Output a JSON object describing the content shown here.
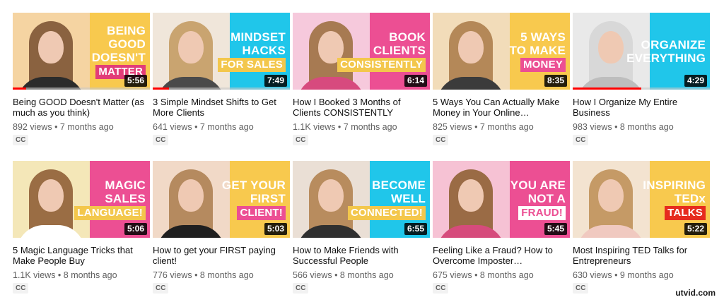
{
  "videos": [
    {
      "title": "Being GOOD Doesn't Matter (as much as you think)",
      "views": "892 views",
      "age": "7 months ago",
      "badge": "CC",
      "duration": "5:56",
      "watched": 0.1,
      "thumbnail": {
        "lines": [
          "BEING",
          "GOOD",
          "DOESN'T",
          "MATTER"
        ],
        "panel_color": "#f8c94e",
        "text_color": "#ffffff",
        "accent_color": "#e23d78",
        "photo_bg": "#f5d4a2",
        "hair_color": "#8a6240",
        "top_color": "#2b2b2b"
      }
    },
    {
      "title": "3 Simple Mindset Shifts to Get More Clients",
      "views": "641 views",
      "age": "7 months ago",
      "badge": "CC",
      "duration": "7:49",
      "watched": 0.12,
      "thumbnail": {
        "lines": [
          "MINDSET",
          "HACKS",
          "FOR SALES"
        ],
        "panel_color": "#20c6ea",
        "text_color": "#ffffff",
        "accent_color": "#f3c74c",
        "photo_bg": "#f0e6da",
        "hair_color": "#c9a470",
        "top_color": "#4a4a4a"
      }
    },
    {
      "title": "How I Booked 3 Months of Clients CONSISTENTLY",
      "views": "1.1K views",
      "age": "7 months ago",
      "badge": "CC",
      "duration": "6:14",
      "watched": 0,
      "thumbnail": {
        "lines": [
          "BOOK",
          "CLIENTS",
          "CONSISTENTLY"
        ],
        "panel_color": "#ec4f93",
        "text_color": "#ffffff",
        "accent_color": "#f3c74c",
        "photo_bg": "#f6c9dc",
        "hair_color": "#a77a52",
        "top_color": "#d74a7e"
      }
    },
    {
      "title": "5 Ways You Can Actually Make Money in Your Online…",
      "views": "825 views",
      "age": "7 months ago",
      "badge": "CC",
      "duration": "8:35",
      "watched": 0,
      "thumbnail": {
        "lines": [
          "5 WAYS",
          "TO MAKE",
          "MONEY"
        ],
        "panel_color": "#f8c94e",
        "text_color": "#ffffff",
        "accent_color": "#ec4f93",
        "photo_bg": "#f2dcb9",
        "hair_color": "#b48858",
        "top_color": "#3b3b3b"
      }
    },
    {
      "title": "How I Organize My Entire Business",
      "views": "983 views",
      "age": "8 months ago",
      "badge": "CC",
      "duration": "4:29",
      "watched": 0.5,
      "thumbnail": {
        "lines": [
          "ORGANIZE",
          "EVERYTHING"
        ],
        "panel_color": "#20c6ea",
        "text_color": "#ffffff",
        "accent_color": "#20c6ea",
        "photo_bg": "#e9e9e9",
        "hair_color": "#d8d8d8",
        "top_color": "#bdbdbd"
      }
    },
    {
      "title": "5 Magic Language Tricks that Make People Buy",
      "views": "1.1K views",
      "age": "8 months ago",
      "badge": "CC",
      "duration": "5:06",
      "watched": 0,
      "thumbnail": {
        "lines": [
          "MAGIC",
          "SALES",
          "LANGUAGE!"
        ],
        "panel_color": "#ec4f93",
        "text_color": "#ffffff",
        "accent_color": "#f3c74c",
        "photo_bg": "#f4e7b8",
        "hair_color": "#9a6d44",
        "top_color": "#ffffff"
      }
    },
    {
      "title": "How to get your FIRST paying client!",
      "views": "776 views",
      "age": "8 months ago",
      "badge": "CC",
      "duration": "5:03",
      "watched": 0,
      "thumbnail": {
        "lines": [
          "GET YOUR",
          "FIRST",
          "CLIENT!"
        ],
        "panel_color": "#f8c94e",
        "text_color": "#ffffff",
        "accent_color": "#ec4f93",
        "photo_bg": "#f1d9c7",
        "hair_color": "#b58a5f",
        "top_color": "#1f1f1f"
      }
    },
    {
      "title": "How to Make Friends with Successful People",
      "views": "566 views",
      "age": "8 months ago",
      "badge": "CC",
      "duration": "6:55",
      "watched": 0,
      "thumbnail": {
        "lines": [
          "BECOME",
          "WELL",
          "CONNECTED!"
        ],
        "panel_color": "#20c6ea",
        "text_color": "#ffffff",
        "accent_color": "#f3c74c",
        "photo_bg": "#eadfd5",
        "hair_color": "#b88c5e",
        "top_color": "#2f2f2f"
      }
    },
    {
      "title": "Feeling Like a Fraud? How to Overcome Imposter…",
      "views": "675 views",
      "age": "8 months ago",
      "badge": "CC",
      "duration": "5:45",
      "watched": 0,
      "thumbnail": {
        "lines": [
          "YOU ARE",
          "NOT A",
          "FRAUD!"
        ],
        "panel_color": "#ec4f93",
        "text_color": "#ffffff",
        "accent_color": "#ffffff",
        "photo_bg": "#f6c2d4",
        "hair_color": "#9a6b45",
        "top_color": "#d64b7c"
      }
    },
    {
      "title": "Most Inspiring TED Talks for Entrepreneurs",
      "views": "630 views",
      "age": "9 months ago",
      "badge": "CC",
      "duration": "5:22",
      "watched": 0,
      "thumbnail": {
        "lines": [
          "INSPIRING",
          "TEDx",
          "TALKS"
        ],
        "panel_color": "#f8c94e",
        "text_color": "#ffffff",
        "accent_color": "#e62b1e",
        "photo_bg": "#f3e3d0",
        "hair_color": "#c59a66",
        "top_color": "#f0c9c0"
      }
    }
  ],
  "watermark": {
    "text": "utvid.com"
  }
}
